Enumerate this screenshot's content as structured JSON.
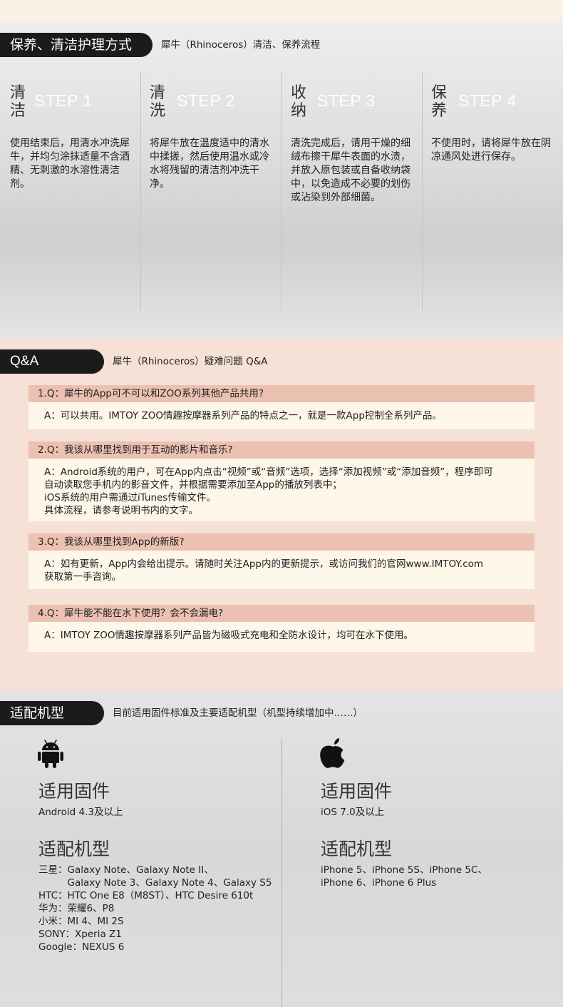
{
  "care": {
    "title": "保养、清洁护理方式",
    "subtitle": "犀牛（Rhinoceros）清洁、保养流程",
    "steps": [
      {
        "c1": "清",
        "c2": "洁",
        "step": "STEP 1",
        "text": "使用结束后，用清水冲洗犀牛，并均匀涂抹适量不含酒精、无刺激的水溶性清洁剂。"
      },
      {
        "c1": "清",
        "c2": "洗",
        "step": "STEP 2",
        "text": "将犀牛放在温度适中的清水中揉搓，然后使用温水或冷水将残留的清洁剂冲洗干净。"
      },
      {
        "c1": "收",
        "c2": "纳",
        "step": "STEP 3",
        "text": "清洗完成后，请用干燥的细绒布擦干犀牛表面的水渍，并放入原包装或自备收纳袋中，以免造成不必要的划伤或沾染到外部细菌。"
      },
      {
        "c1": "保",
        "c2": "养",
        "step": "STEP 4",
        "text": "不使用时，请将犀牛放在阴凉通风处进行保存。"
      }
    ]
  },
  "qa": {
    "title": "Q&A",
    "subtitle": "犀牛（Rhinoceros）疑难问题 Q&A",
    "items": [
      {
        "q": "1.Q：犀牛的App可不可以和ZOO系列其他产品共用?",
        "a": [
          "A：可以共用。IMTOY ZOO情趣按摩器系列产品的特点之一，就是一款App控制全系列产品。"
        ]
      },
      {
        "q": "2.Q：我该从哪里找到用于互动的影片和音乐?",
        "a": [
          "A：Android系统的用户，可在App内点击“视频”或“音频”选项，选择“添加视频”或“添加音频”，程序即可",
          "自动读取您手机内的影音文件，并根据需要添加至App的播放列表中；",
          "iOS系统的用户需通过iTunes传输文件。",
          "具体流程，请参考说明书内的文字。"
        ]
      },
      {
        "q": "3.Q：我该从哪里找到App的新版?",
        "a": [
          "A：如有更新，App内会给出提示。请随时关注App内的更新提示，或访问我们的官网www.IMTOY.com",
          "获取第一手咨询。"
        ]
      },
      {
        "q": "4.Q：犀牛能不能在水下使用？会不会漏电?",
        "a": [
          "A：IMTOY ZOO情趣按摩器系列产品皆为磁吸式充电和全防水设计，均可在水下使用。"
        ]
      }
    ]
  },
  "compat": {
    "title": "适配机型",
    "subtitle": "目前适用固件标准及主要适配机型（机型持续增加中……）",
    "android": {
      "icon": "android-icon",
      "firmware_heading": "适用固件",
      "firmware": "Android 4.3及以上",
      "models_heading": "适配机型",
      "models": [
        "三星：Galaxy Note、Galaxy Note II、",
        "　　　Galaxy Note 3、Galaxy Note 4、Galaxy S5",
        "HTC：HTC One E8（M8ST）、HTC Desire 610t",
        "华为：荣耀6、P8",
        "小米：MI 4、MI 2S",
        "SONY：Xperia Z1",
        "Google：NEXUS 6"
      ]
    },
    "ios": {
      "icon": "apple-icon",
      "firmware_heading": "适用固件",
      "firmware": "iOS 7.0及以上",
      "models_heading": "适配机型",
      "models": [
        "iPhone 5、iPhone 5S、iPhone 5C、",
        "iPhone 6、iPhone 6 Plus"
      ]
    }
  }
}
